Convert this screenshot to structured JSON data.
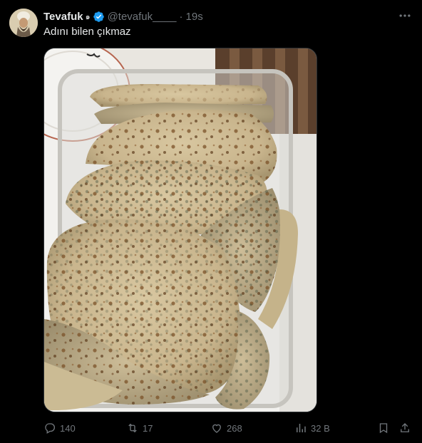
{
  "tweet": {
    "author_name": "Tevafuk",
    "author_mark": "๑",
    "handle": "@tevafuk____",
    "separator": "·",
    "time": "19s",
    "text": "Adını bilen çıkmaz"
  },
  "actions": {
    "replies": "140",
    "reposts": "17",
    "likes": "268",
    "views": "32 B"
  },
  "colors": {
    "background": "#000000",
    "text": "#e7e9ea",
    "muted": "#71767b",
    "verified": "#1d9bf0"
  },
  "icons": [
    "avatar",
    "verified-badge-icon",
    "more-icon",
    "reply-icon",
    "repost-icon",
    "like-icon",
    "views-icon",
    "bookmark-icon",
    "share-icon"
  ]
}
